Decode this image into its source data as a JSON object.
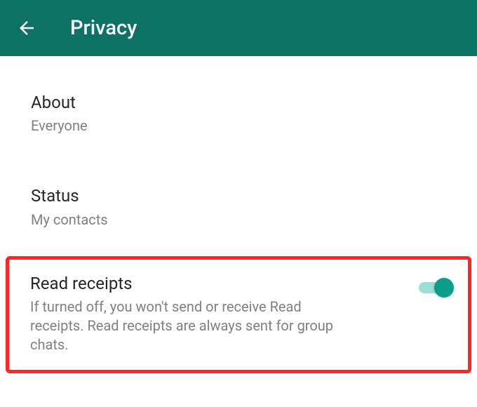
{
  "header": {
    "title": "Privacy"
  },
  "settings": {
    "about": {
      "title": "About",
      "value": "Everyone"
    },
    "status": {
      "title": "Status",
      "value": "My contacts"
    },
    "read_receipts": {
      "title": "Read receipts",
      "description": "If turned off, you won't send or receive Read receipts. Read receipts are always sent for group chats.",
      "enabled": true
    }
  },
  "colors": {
    "header_bg": "#0d7164",
    "highlight_border": "#ff271f",
    "toggle_on": "#0b9e89",
    "toggle_track": "#9adfd4"
  }
}
